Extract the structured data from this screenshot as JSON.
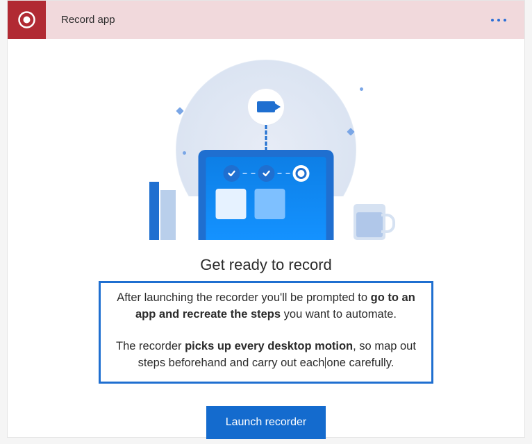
{
  "header": {
    "title": "Record app"
  },
  "content": {
    "heading": "Get ready to record",
    "p1_a": "After launching the recorder you'll be prompted to ",
    "p1_b": "go to an app and recreate the steps",
    "p1_c": " you want to automate.",
    "p2_a": "The recorder ",
    "p2_b": "picks up every desktop motion",
    "p2_c": ", so map out steps beforehand and carry out each",
    "p2_d": "one carefully."
  },
  "actions": {
    "launch_label": "Launch recorder"
  }
}
